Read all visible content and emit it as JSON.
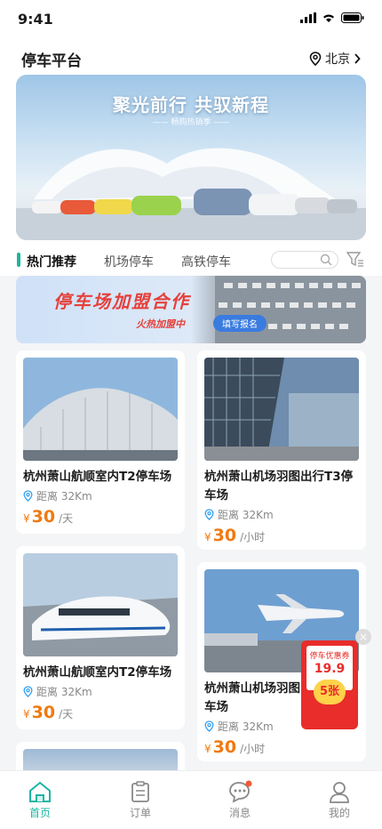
{
  "status": {
    "time": "9:41"
  },
  "header": {
    "title": "停车平台",
    "city": "北京"
  },
  "banner": {
    "headline": "聚光前行 共驭新程",
    "subline": "—— 畅购热销季 ——"
  },
  "tabs": [
    {
      "label": "热门推荐",
      "active": true
    },
    {
      "label": "机场停车",
      "active": false
    },
    {
      "label": "高铁停车",
      "active": false
    }
  ],
  "promo": {
    "title": "停车场加盟合作",
    "tag": "火热加盟中",
    "button": "填写报名"
  },
  "cards": [
    {
      "name": "杭州萧山航顺室内T2停车场",
      "distance": "距离 32Km",
      "currency": "¥",
      "price": "30",
      "unit": "/天"
    },
    {
      "name": "杭州萧山机场羽图出行T3停车场",
      "distance": "距离 32Km",
      "currency": "¥",
      "price": "30",
      "unit": "/小时"
    },
    {
      "name": "杭州萧山航顺室内T2停车场",
      "distance": "距离 32Km",
      "currency": "¥",
      "price": "30",
      "unit": "/天"
    },
    {
      "name": "杭州萧山机场羽图出行T3停车场",
      "distance": "距离 32Km",
      "currency": "¥",
      "price": "30",
      "unit": "/小时"
    }
  ],
  "coupon": {
    "title": "停车优惠券",
    "amount": "19.9",
    "count": "5张"
  },
  "tabbar": [
    {
      "label": "首页",
      "icon": "home-icon",
      "active": true
    },
    {
      "label": "订单",
      "icon": "order-icon",
      "active": false
    },
    {
      "label": "消息",
      "icon": "message-icon",
      "active": false
    },
    {
      "label": "我的",
      "icon": "user-icon",
      "active": false
    }
  ],
  "colors": {
    "accent": "#1bb5a3",
    "price": "#f07a12",
    "coupon": "#e82d2a"
  }
}
